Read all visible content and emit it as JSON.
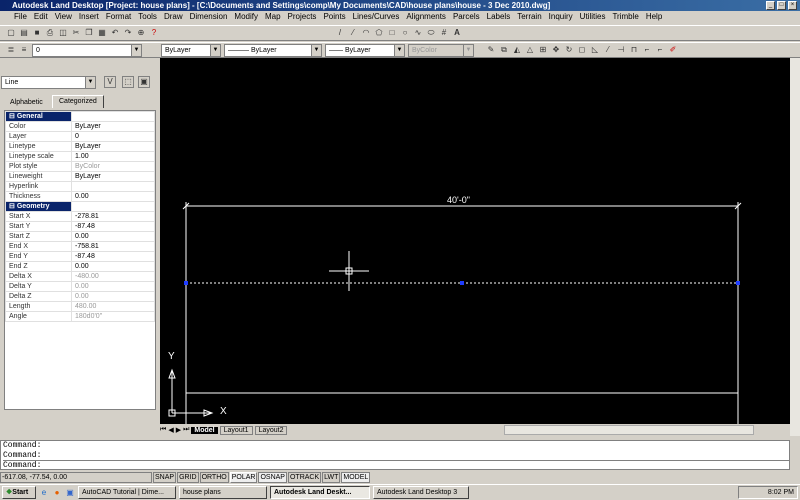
{
  "window": {
    "title": "Autodesk Land Desktop [Project: house plans] - [C:\\Documents and Settings\\comp\\My Documents\\CAD\\house plans\\house - 3 Dec 2010.dwg]"
  },
  "menu": [
    "File",
    "Edit",
    "View",
    "Insert",
    "Format",
    "Tools",
    "Draw",
    "Dimension",
    "Modify",
    "Map",
    "Projects",
    "Points",
    "Lines/Curves",
    "Alignments",
    "Parcels",
    "Labels",
    "Terrain",
    "Inquiry",
    "Utilities",
    "Trimble",
    "Help"
  ],
  "toolbar": {
    "layer": "0",
    "color": "ByLayer",
    "linetype": "ByLayer",
    "lineweight": "ByLayer",
    "plotstyle": "ByColor"
  },
  "properties": {
    "selection": "Line",
    "tabs": [
      "Alphabetic",
      "Categorized"
    ],
    "general_label": "General",
    "general": [
      [
        "Color",
        "ByLayer"
      ],
      [
        "Layer",
        "0"
      ],
      [
        "Linetype",
        "ByLayer"
      ],
      [
        "Linetype scale",
        "1.00"
      ],
      [
        "Plot style",
        "ByColor"
      ],
      [
        "Lineweight",
        "ByLayer"
      ],
      [
        "Hyperlink",
        ""
      ],
      [
        "Thickness",
        "0.00"
      ]
    ],
    "geometry_label": "Geometry",
    "geometry": [
      [
        "Start X",
        "-278.81"
      ],
      [
        "Start Y",
        "-87.48"
      ],
      [
        "Start Z",
        "0.00"
      ],
      [
        "End X",
        "-758.81"
      ],
      [
        "End Y",
        "-87.48"
      ],
      [
        "End Z",
        "0.00"
      ],
      [
        "Delta X",
        "-480.00"
      ],
      [
        "Delta Y",
        "0.00"
      ],
      [
        "Delta Z",
        "0.00"
      ],
      [
        "Length",
        "480.00"
      ],
      [
        "Angle",
        "180d0'0\""
      ]
    ]
  },
  "drawing": {
    "dimension": "40'-0\"",
    "ucs_x": "X",
    "ucs_y": "Y",
    "layout_tabs": [
      "Model",
      "Layout1",
      "Layout2"
    ]
  },
  "command": {
    "lines": [
      "Command:",
      "Command:",
      "Command:"
    ]
  },
  "status": {
    "coords": "-617.08, -77.54, 0.00",
    "toggles": [
      "SNAP",
      "GRID",
      "ORTHO",
      "POLAR",
      "OSNAP",
      "OTRACK",
      "LWT",
      "MODEL"
    ]
  },
  "taskbar": {
    "start": "Start",
    "tasks": [
      "AutoCAD Tutorial | Dime...",
      "house plans",
      "Autodesk Land Deskt...",
      "Autodesk Land Desktop 3"
    ],
    "clock": "8:02 PM"
  }
}
